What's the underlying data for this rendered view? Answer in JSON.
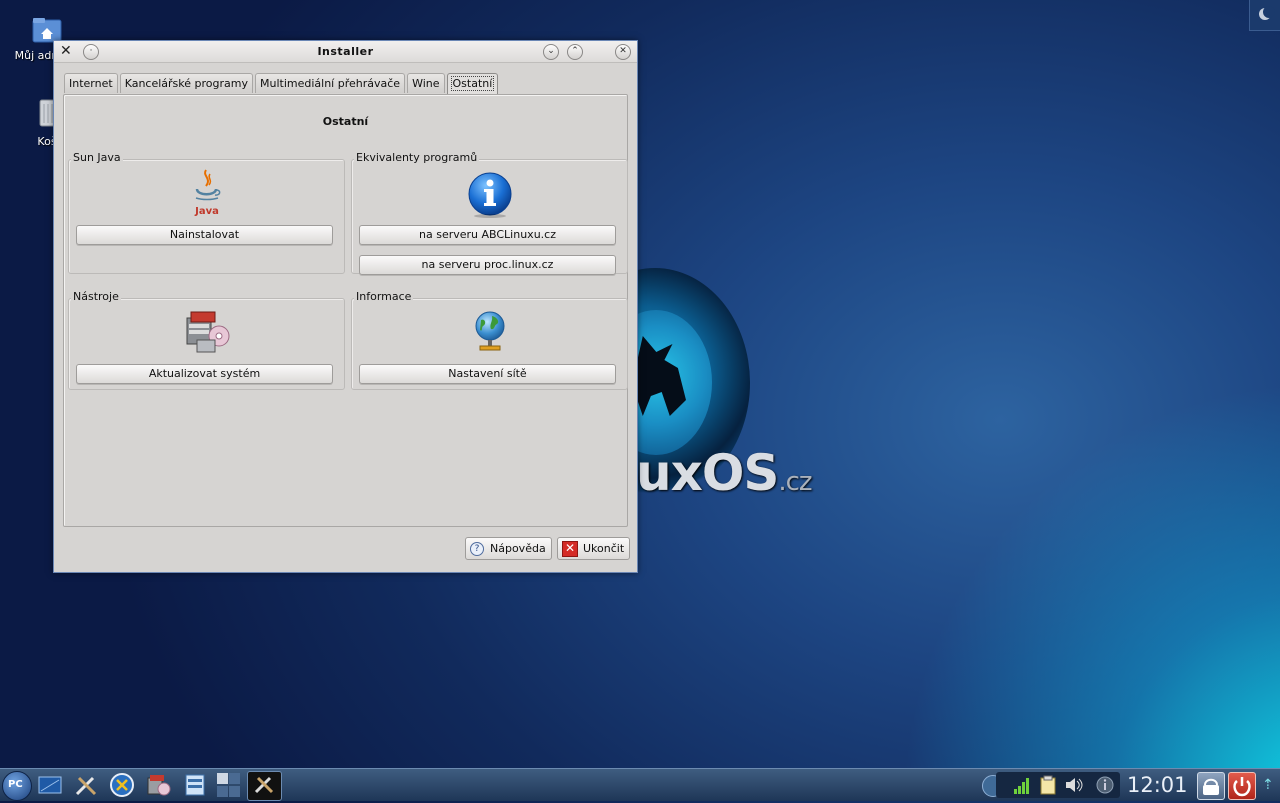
{
  "desktop": {
    "icons": [
      {
        "label": "Můj adresář"
      },
      {
        "label": "Koš"
      }
    ],
    "wallpaper_text": {
      "main": "uxOS",
      "suffix": ".cz"
    }
  },
  "window": {
    "title": "Installer",
    "tabs": [
      {
        "label": "Internet"
      },
      {
        "label": "Kancelářské programy"
      },
      {
        "label": "Multimediální přehrávače"
      },
      {
        "label": "Wine"
      },
      {
        "label": "Ostatní",
        "active": true
      }
    ],
    "panel_title": "Ostatní",
    "groups": {
      "sun_java": {
        "title": "Sun Java",
        "icon": "java-icon",
        "button": "Nainstalovat"
      },
      "ekvivalenty": {
        "title": "Ekvivalenty programů",
        "icon": "info-icon",
        "button1": "na serveru ABCLinuxu.cz",
        "button2": "na serveru proc.linux.cz"
      },
      "nastroje": {
        "title": "Nástroje",
        "icon": "package-manager-icon",
        "button": "Aktualizovat systém"
      },
      "informace": {
        "title": "Informace",
        "icon": "network-globe-icon",
        "button": "Nastavení sítě"
      }
    },
    "help_button": "Nápověda",
    "quit_button": "Ukončit"
  },
  "taskbar": {
    "start_label": "PC",
    "clock": "12:01"
  },
  "colors": {
    "window_bg": "#d6d4d2",
    "taskbar": "#2a4468",
    "accent": "#1a8ec4",
    "quit_red": "#d42b26"
  }
}
